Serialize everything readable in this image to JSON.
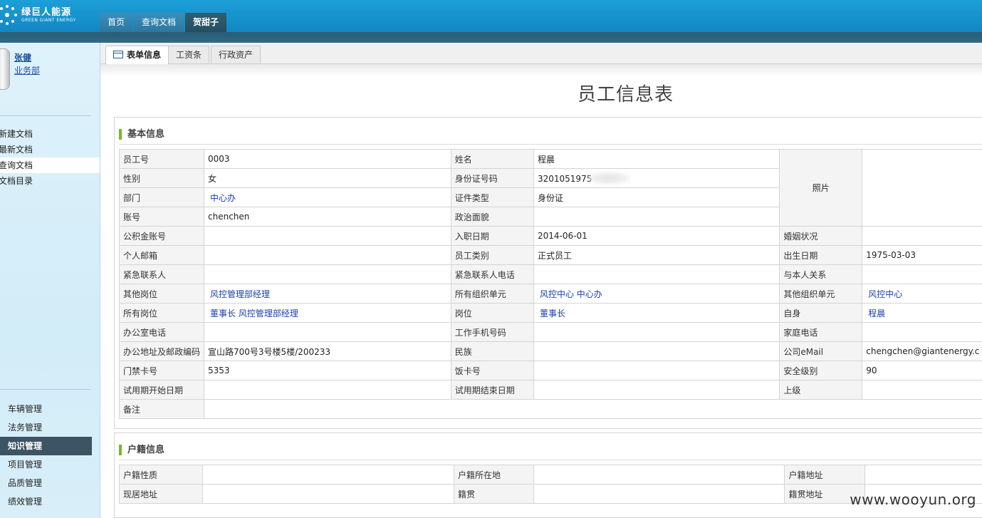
{
  "header": {
    "logo_cn": "绿巨人能源",
    "logo_en": "GREEN GIANT ENERGY",
    "tabs": [
      {
        "label": "首页"
      },
      {
        "label": "查询文档"
      },
      {
        "label": "贺甜子"
      }
    ]
  },
  "sidebar": {
    "user_name": "张健",
    "user_dept": "业务部",
    "doc_items": [
      {
        "label": "新建文档"
      },
      {
        "label": "最新文档"
      },
      {
        "label": "查询文档"
      },
      {
        "label": "文档目录"
      }
    ],
    "module_items": [
      {
        "label": "车辆管理"
      },
      {
        "label": "法务管理"
      },
      {
        "label": "知识管理"
      },
      {
        "label": "项目管理"
      },
      {
        "label": "品质管理"
      },
      {
        "label": "绩效管理"
      }
    ]
  },
  "subtabs": [
    {
      "label": "表单信息"
    },
    {
      "label": "工资条"
    },
    {
      "label": "行政资产"
    }
  ],
  "page_title": "员工信息表",
  "basic": {
    "heading": "基本信息",
    "emp_no_label": "员工号",
    "emp_no": "0003",
    "name_label": "姓名",
    "name": "程晨",
    "photo_label": "照片",
    "gender_label": "性别",
    "gender": "女",
    "id_label": "身份证号码",
    "id_value": "3201051975",
    "dept_label": "部门",
    "dept": "中心办",
    "cert_label": "证件类型",
    "cert": "身份证",
    "account_label": "账号",
    "account": "chenchen",
    "politic_label": "政治面貌",
    "fund_label": "公积金账号",
    "entry_label": "入职日期",
    "entry": "2014-06-01",
    "marital_label": "婚姻状况",
    "email_label": "个人邮箱",
    "emp_type_label": "员工类别",
    "emp_type": "正式员工",
    "birth_label": "出生日期",
    "birth": "1975-03-03",
    "contact_label": "紧急联系人",
    "contact_tel_label": "紧急联系人电话",
    "relation_label": "与本人关系",
    "other_post_label": "其他岗位",
    "other_post": "风控管理部经理",
    "org_units_label": "所有组织单元",
    "org_units": "风控中心  中心办",
    "other_org_label": "其他组织单元",
    "other_org": "风控中心",
    "all_posts_label": "所有岗位",
    "all_posts": "董事长  风控管理部经理",
    "post_label": "岗位",
    "post": "董事长",
    "self_label": "自身",
    "self": "程晨",
    "office_tel_label": "办公室电话",
    "mobile_label": "工作手机号码",
    "home_tel_label": "家庭电话",
    "office_addr_label": "办公地址及邮政编码",
    "office_addr": "宣山路700号3号楼5楼/200233",
    "nation_label": "民族",
    "company_email_label": "公司eMail",
    "company_email": "chengchen@giantenergy.c",
    "door_card_label": "门禁卡号",
    "door_card": "5353",
    "meal_card_label": "饭卡号",
    "security_label": "安全级别",
    "security": "90",
    "trial_start_label": "试用期开始日期",
    "trial_end_label": "试用期结束日期",
    "superior_label": "上级",
    "remark_label": "备注"
  },
  "household": {
    "heading": "户籍信息",
    "type_label": "户籍性质",
    "location_label": "户籍所在地",
    "address_label": "户籍地址",
    "current_addr_label": "现居地址",
    "native_label": "籍贯",
    "native_addr_label": "籍贯地址"
  },
  "watermark": "www.wooyun.org"
}
